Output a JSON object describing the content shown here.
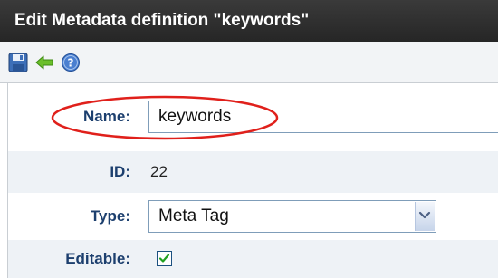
{
  "window": {
    "title": "Edit Metadata definition \"keywords\""
  },
  "toolbar": {
    "buttons": [
      {
        "icon": "save-icon",
        "tooltip": ""
      },
      {
        "icon": "back-arrow-icon",
        "tooltip": ""
      },
      {
        "icon": "help-icon",
        "tooltip": ""
      }
    ]
  },
  "form": {
    "name": {
      "label": "Name:",
      "value": "keywords"
    },
    "id": {
      "label": "ID:",
      "value": "22"
    },
    "type": {
      "label": "Type:",
      "value": "Meta Tag"
    },
    "editable": {
      "label": "Editable:",
      "checked": true
    }
  },
  "colors": {
    "title_bar": "#2f2f2f",
    "label_text": "#1c3f6e",
    "annotation_circle": "#e0201b",
    "alt_row": "#eef2f6"
  }
}
